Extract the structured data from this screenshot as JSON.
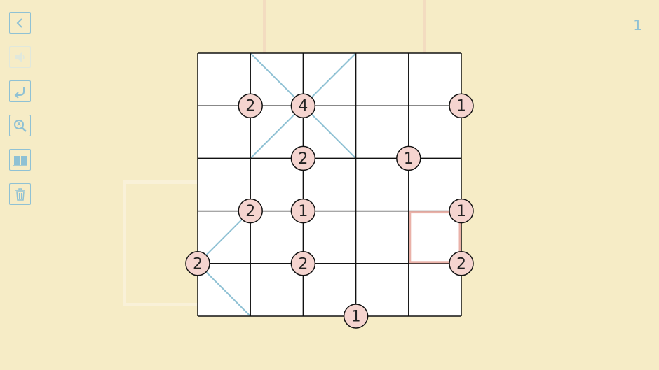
{
  "level": {
    "number": "1"
  },
  "toolbar": {
    "buttons": [
      {
        "name": "back-button",
        "icon": "chevron-left-icon",
        "enabled": true
      },
      {
        "name": "sound-button",
        "icon": "speaker-icon",
        "enabled": false
      },
      {
        "name": "undo-button",
        "icon": "undo-arrow-icon",
        "enabled": true
      },
      {
        "name": "hint-button",
        "icon": "magnifier-icon",
        "enabled": true
      },
      {
        "name": "rules-button",
        "icon": "book-icon",
        "enabled": true
      },
      {
        "name": "clear-button",
        "icon": "trash-icon",
        "enabled": true
      }
    ]
  },
  "puzzle": {
    "rows": 5,
    "cols": 5,
    "clues": [
      {
        "r": 1,
        "c": 1,
        "value": "2"
      },
      {
        "r": 1,
        "c": 2,
        "value": "4"
      },
      {
        "r": 1,
        "c": 5,
        "value": "1"
      },
      {
        "r": 2,
        "c": 2,
        "value": "2"
      },
      {
        "r": 2,
        "c": 4,
        "value": "1"
      },
      {
        "r": 3,
        "c": 1,
        "value": "2"
      },
      {
        "r": 3,
        "c": 2,
        "value": "1"
      },
      {
        "r": 3,
        "c": 5,
        "value": "1"
      },
      {
        "r": 4,
        "c": 0,
        "value": "2"
      },
      {
        "r": 4,
        "c": 2,
        "value": "2"
      },
      {
        "r": 4,
        "c": 5,
        "value": "2"
      },
      {
        "r": 5,
        "c": 3,
        "value": "1"
      }
    ],
    "diagonals": [
      {
        "row": 0,
        "col": 1,
        "dir": "\\"
      },
      {
        "row": 0,
        "col": 2,
        "dir": "/"
      },
      {
        "row": 1,
        "col": 1,
        "dir": "/"
      },
      {
        "row": 1,
        "col": 2,
        "dir": "\\"
      },
      {
        "row": 3,
        "col": 0,
        "dir": "/"
      },
      {
        "row": 4,
        "col": 0,
        "dir": "\\"
      }
    ],
    "selected_cell": {
      "row": 3,
      "col": 4
    },
    "colors": {
      "grid": "#111111",
      "cell": "#ffffff",
      "diagonal": "#8fc1d4",
      "clue_fill": "#f5d4cf",
      "selection": "#eab1a8",
      "accent": "#8fc1d4"
    }
  }
}
